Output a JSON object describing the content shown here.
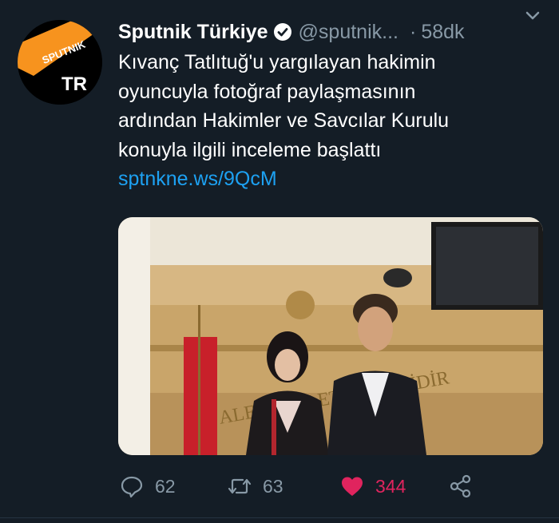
{
  "tweet": {
    "author": {
      "name": "Sputnik Türkiye",
      "handle": "@sputnik...",
      "verified": true,
      "avatar": {
        "logo_word": "SPUTNIK",
        "badge": "TR",
        "accent": "#f7931e"
      }
    },
    "separator": "·",
    "time": "58dk",
    "text_lines": [
      "Kıvanç Tatlıtuğ'u yargılayan hakimin",
      "oyuncuyla fotoğraf paylaşmasının",
      "ardından Hakimler ve Savcılar Kurulu",
      "konuyla ilgili inceleme başlattı"
    ],
    "link": "sptnkne.ws/9QcM",
    "media": {
      "wall_lettering": "ALET MİLLETİN TEŞLİDİR"
    },
    "actions": {
      "reply": {
        "icon": "reply-icon",
        "count": "62"
      },
      "retweet": {
        "icon": "retweet-icon",
        "count": "63"
      },
      "like": {
        "icon": "heart-icon",
        "count": "344",
        "color": "#e0245e"
      },
      "share": {
        "icon": "share-icon"
      }
    }
  },
  "colors": {
    "background": "#141d26",
    "text": "#ffffff",
    "muted": "#8899a6",
    "link": "#1da1f2"
  }
}
